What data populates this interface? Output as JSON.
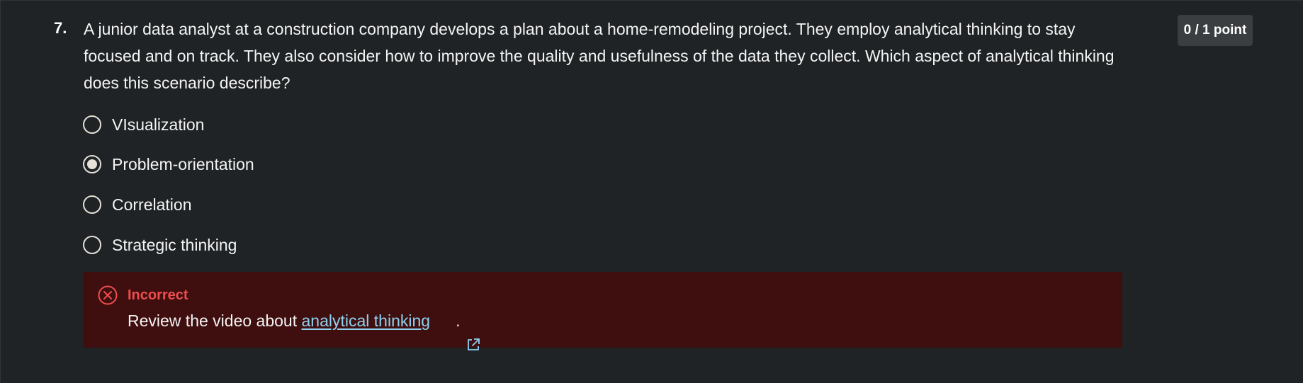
{
  "question": {
    "number": "7.",
    "text": "A junior data analyst at a construction company develops a plan about a home-remodeling project. They employ analytical thinking to stay focused and on track. They also consider how to improve the quality and usefulness of the data they collect. Which aspect of analytical thinking does this scenario describe?",
    "score": "0 / 1 point"
  },
  "options": [
    {
      "label": "VIsualization",
      "selected": false
    },
    {
      "label": "Problem-orientation",
      "selected": true
    },
    {
      "label": "Correlation",
      "selected": false
    },
    {
      "label": "Strategic thinking",
      "selected": false
    }
  ],
  "feedback": {
    "status": "Incorrect",
    "prefix": "Review the video about ",
    "link_text": "analytical thinking",
    "suffix": ".",
    "status_icon": "x-circle-icon",
    "link_icon": "external-link-icon"
  },
  "colors": {
    "background": "#1f2325",
    "feedback_bg": "#3f0e0f",
    "error": "#ef4d4d",
    "link": "#8ed2f2"
  }
}
